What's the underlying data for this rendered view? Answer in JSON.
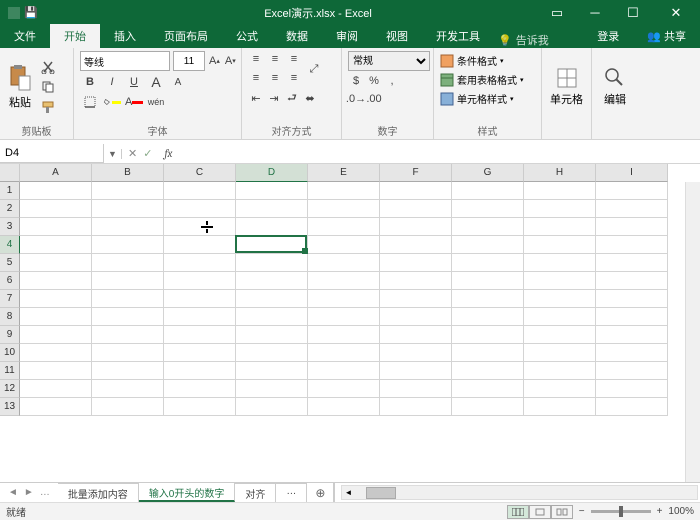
{
  "title": "Excel演示.xlsx - Excel",
  "tabs": {
    "file": "文件",
    "home": "开始",
    "insert": "插入",
    "layout": "页面布局",
    "formulas": "公式",
    "data": "数据",
    "review": "审阅",
    "view": "视图",
    "dev": "开发工具",
    "tell": "告诉我",
    "login": "登录",
    "share": "共享"
  },
  "ribbon": {
    "clipboard": {
      "label": "剪贴板",
      "paste": "粘贴"
    },
    "font": {
      "label": "字体",
      "name": "等线",
      "size": "11",
      "bold": "B",
      "italic": "I",
      "underline": "U",
      "bigA": "A",
      "smallA": "A",
      "wen": "wén"
    },
    "align": {
      "label": "对齐方式"
    },
    "number": {
      "label": "数字",
      "format": "常规"
    },
    "styles": {
      "label": "样式",
      "cond": "条件格式",
      "table": "套用表格格式",
      "cell": "单元格样式"
    },
    "cells": {
      "label": "单元格",
      "btn": "单元格"
    },
    "edit": {
      "label": "编辑",
      "btn": "编辑"
    }
  },
  "namebox": {
    "ref": "D4",
    "fx": "fx"
  },
  "columns": [
    "A",
    "B",
    "C",
    "D",
    "E",
    "F",
    "G",
    "H",
    "I"
  ],
  "rows": [
    "1",
    "2",
    "3",
    "4",
    "5",
    "6",
    "7",
    "8",
    "9",
    "10",
    "11",
    "12",
    "13"
  ],
  "active": {
    "col": 3,
    "row": 3
  },
  "sheets": {
    "s1": "批量添加内容",
    "s2": "输入0开头的数字",
    "s3": "对齐",
    "add": "⊕"
  },
  "status": {
    "ready": "就绪",
    "zoom": "100%"
  }
}
